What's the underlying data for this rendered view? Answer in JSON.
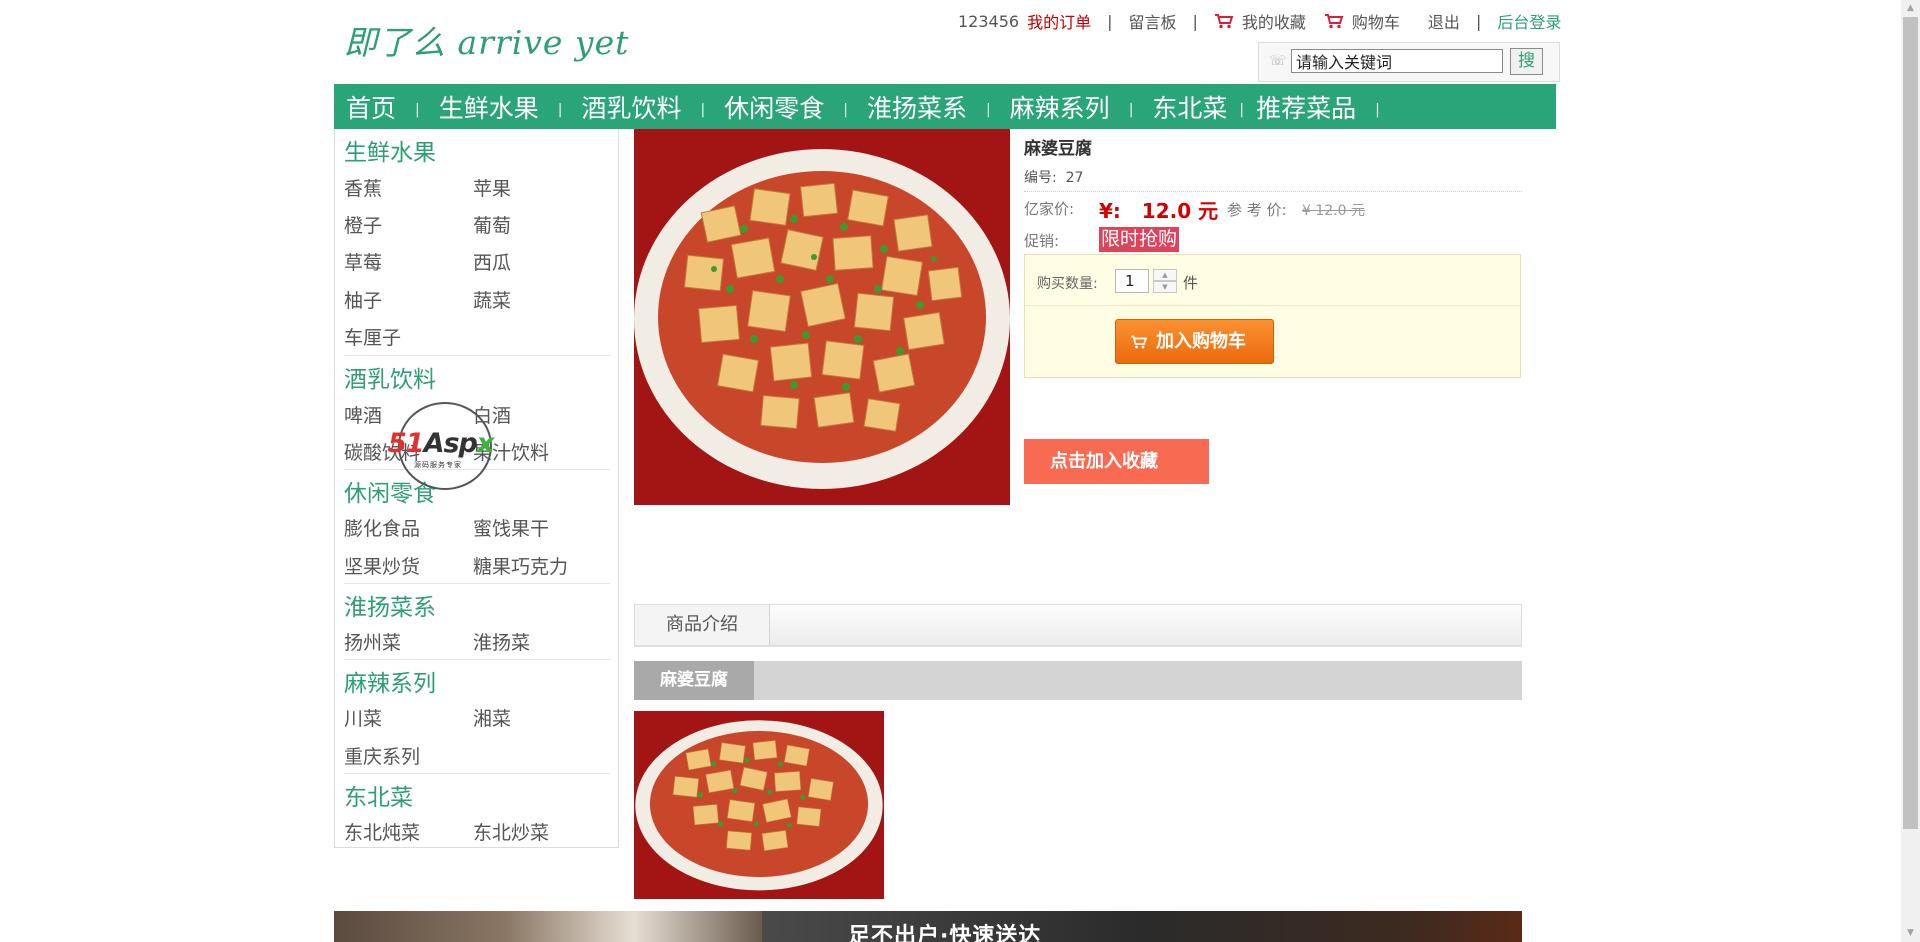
{
  "site": {
    "logo": "即了么 arrive  yet"
  },
  "topbar": {
    "username": "123456",
    "orders": "我的订单",
    "guestbook": "留言板",
    "favorites": "我的收藏",
    "cart": "购物车",
    "logout": "退出",
    "admin_login": "后台登录",
    "separator": "|"
  },
  "search": {
    "value": "请输入关键词",
    "button": "搜"
  },
  "nav": {
    "items": [
      "首页",
      "生鲜水果",
      "酒乳饮料",
      "休闲零食",
      "淮扬菜系",
      "麻辣系列",
      "东北菜",
      "推荐菜品"
    ],
    "separator": "|"
  },
  "sidebar": {
    "categories": [
      {
        "title": "生鲜水果",
        "items": [
          "香蕉",
          "苹果",
          "橙子",
          "葡萄",
          "草莓",
          "西瓜",
          "柚子",
          "蔬菜",
          "车厘子"
        ]
      },
      {
        "title": "酒乳饮料",
        "items": [
          "啤酒",
          "白酒",
          "碳酸饮料",
          "果汁饮料"
        ]
      },
      {
        "title": "休闲零食",
        "items": [
          "膨化食品",
          "蜜饯果干",
          "坚果炒货",
          "糖果巧克力"
        ]
      },
      {
        "title": "淮扬菜系",
        "items": [
          "扬州菜",
          "淮扬菜"
        ]
      },
      {
        "title": "麻辣系列",
        "items": [
          "川菜",
          "湘菜",
          "重庆系列"
        ]
      },
      {
        "title": "东北菜",
        "items": [
          "东北炖菜",
          "东北炒菜"
        ]
      }
    ]
  },
  "watermark": {
    "part1": "51",
    "part2": "Asp",
    "part3": "x",
    "sub": "源码服务专家"
  },
  "product": {
    "name": "麻婆豆腐",
    "code_label": "编号:",
    "code": "27",
    "price_label": "亿家价:",
    "price": "¥:   12.0 元",
    "ref_label": "参 考 价:",
    "ref_price": "¥ 12.0 元",
    "promo_label": "促销:",
    "promo": "限时抢购",
    "qty_label": "购买数量:",
    "qty": "1",
    "qty_unit": "件",
    "add_to_cart": "加入购物车",
    "add_favorite": "点击加入收藏"
  },
  "tabs": {
    "intro": "商品介绍"
  },
  "intro": {
    "title": "麻婆豆腐"
  },
  "banner": {
    "text": "足不出户·快速送达"
  },
  "colors": {
    "brand_green": "#2aa57a",
    "price_red": "#d40000",
    "promo_pink": "#e0425b",
    "cart_orange": "#f07a1a",
    "fav_red": "#f96a53"
  }
}
